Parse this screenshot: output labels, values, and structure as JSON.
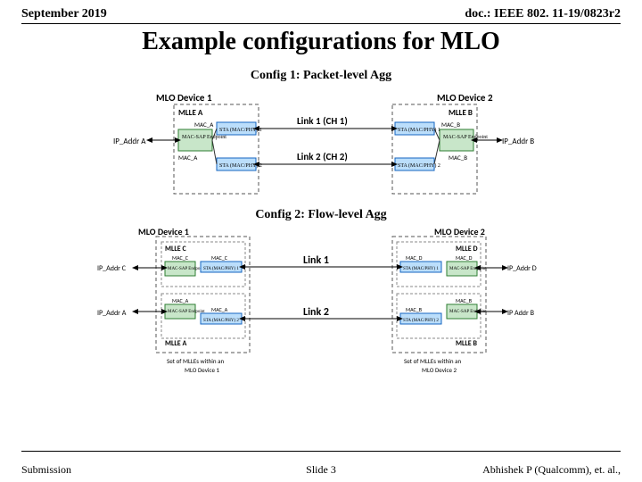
{
  "header": {
    "date": "September 2019",
    "doc": "doc.: IEEE 802. 11-19/0823r2"
  },
  "title": "Example configurations for MLO",
  "cfg1": {
    "label": "Config 1: Packet-level Agg",
    "dev1": "MLO Device 1",
    "dev2": "MLO Device 2",
    "mlleA": "MLLE A",
    "mlleB": "MLLE B",
    "macA": "MAC_A",
    "macB": "MAC_B",
    "ipA": "IP_Addr A",
    "ipB": "IP_Addr B",
    "sap": "MAC-SAP Endpoint",
    "sta1": "STA (MAC/PHY) 1",
    "sta2": "STA (MAC/PHY) 2",
    "link1": "Link 1 (CH 1)",
    "link2": "Link 2 (CH 2)"
  },
  "cfg2": {
    "label": "Config 2: Flow-level Agg",
    "dev1": "MLO Device 1",
    "dev2": "MLO Device 2",
    "mlleA": "MLLE A",
    "mlleB": "MLLE B",
    "mlleC": "MLLE C",
    "mlleD": "MLLE D",
    "macA": "MAC_A",
    "macB": "MAC_B",
    "macC": "MAC_C",
    "macD": "MAC_D",
    "ipC": "IP_Addr C",
    "ipA": "IP_Addr A",
    "ipD": "IP_Addr D",
    "ipB": "IP Addr B",
    "sap": "MAC-SAP Endpoint",
    "sta1": "STA (MAC/PHY) 1",
    "sta2": "STA (MAC/PHY) 2",
    "link1": "Link 1",
    "link2": "Link 2",
    "set1": "Set of MLLEs within an MLO Device 1",
    "set2": "Set of MLLEs within an MLO Device 2"
  },
  "footer": {
    "left": "Submission",
    "center": "Slide 3",
    "right": "Abhishek P (Qualcomm), et. al.,"
  }
}
